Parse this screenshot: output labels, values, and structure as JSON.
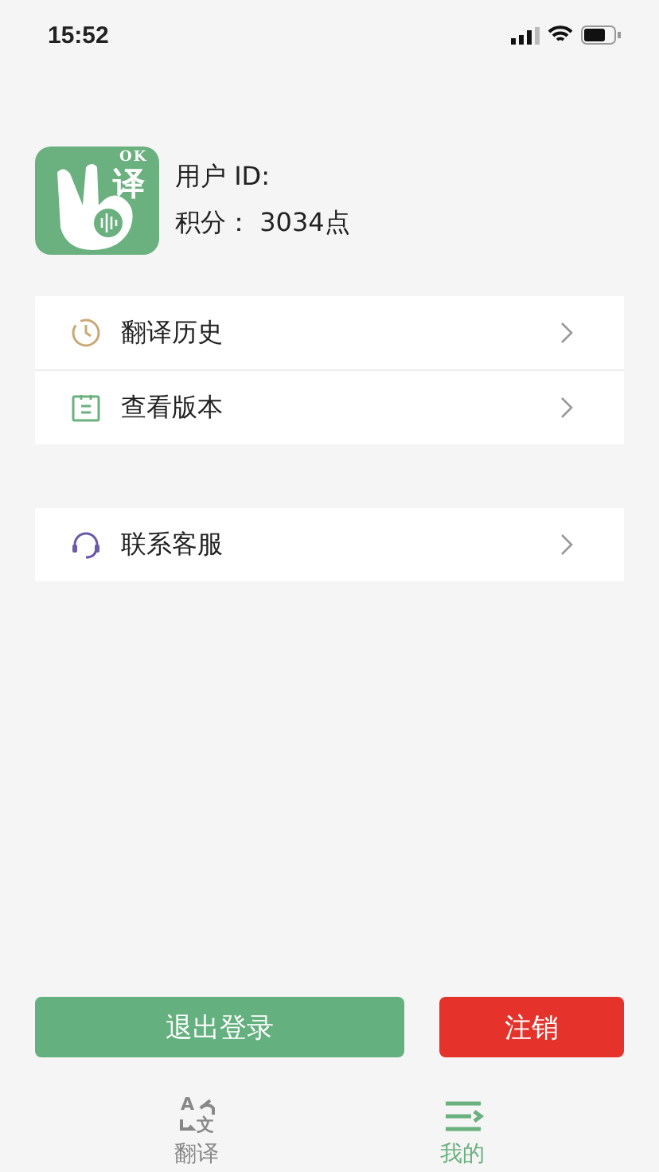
{
  "status_bar": {
    "time": "15:52"
  },
  "profile": {
    "logo": {
      "top": "OK",
      "main": "译"
    },
    "user_id_label": "用户 ID:",
    "points": "积分： 3034点"
  },
  "menu_groups": [
    [
      {
        "label": "翻译历史",
        "kind": "history"
      },
      {
        "label": "查看版本",
        "kind": "version"
      }
    ],
    [
      {
        "label": "联系客服",
        "kind": "support"
      }
    ]
  ],
  "buttons": [
    {
      "label": "退出登录",
      "kind": "logout"
    },
    {
      "label": "注销",
      "kind": "delete"
    }
  ],
  "tabs": [
    {
      "label": "翻译",
      "kind": "translate",
      "glyphs": [
        "A",
        "文"
      ],
      "selected": false
    },
    {
      "label": "我的",
      "kind": "mine",
      "selected": true
    }
  ]
}
